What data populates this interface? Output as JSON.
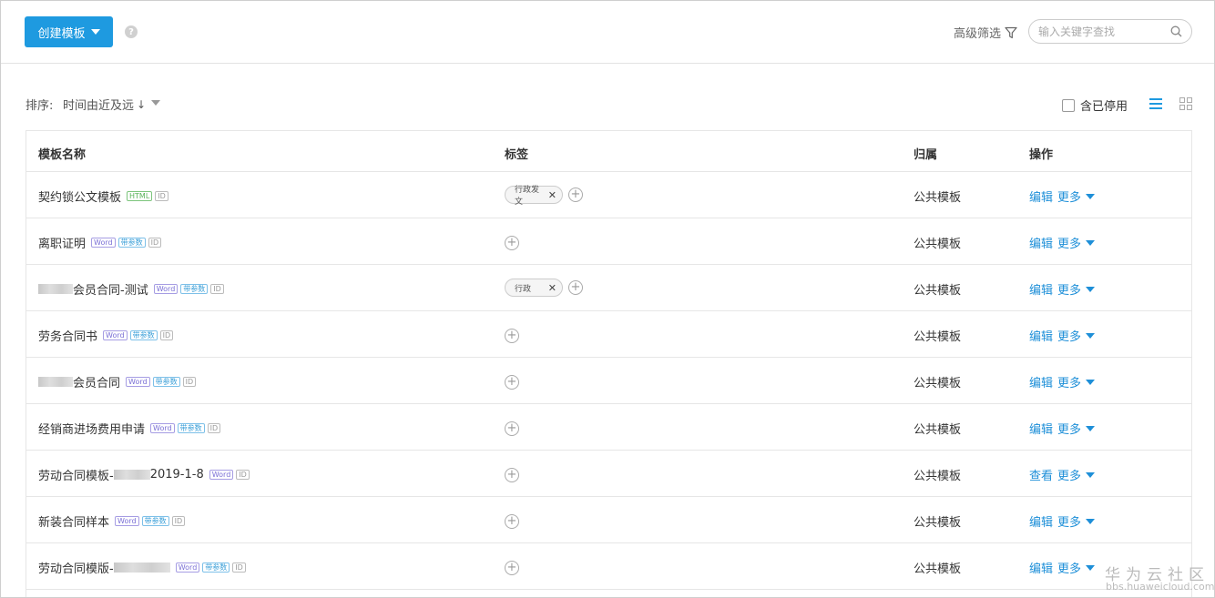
{
  "toolbar": {
    "create_label": "创建模板",
    "help_label": "?",
    "advanced_filter_label": "高级筛选",
    "search_placeholder": "输入关键字查找"
  },
  "sortbar": {
    "sort_label": "排序:",
    "sort_value": "时间由近及远",
    "sort_arrow": "↓",
    "include_disabled_label": "含已停用"
  },
  "table": {
    "headers": {
      "name": "模板名称",
      "tags": "标签",
      "owner": "归属",
      "ops": "操作"
    },
    "rows": [
      {
        "name_prefix": "",
        "name_suffix": "契约锁公文模板",
        "badges": [
          "HTML",
          "ID"
        ],
        "tags": [
          "行政发文"
        ],
        "owner": "公共模板",
        "action": "编辑",
        "more": "更多"
      },
      {
        "name_prefix": "",
        "name_suffix": "离职证明",
        "badges": [
          "Word",
          "带参数",
          "ID"
        ],
        "tags": [],
        "owner": "公共模板",
        "action": "编辑",
        "more": "更多"
      },
      {
        "name_prefix": "",
        "name_suffix": "会员合同-测试",
        "badges": [
          "Word",
          "带参数",
          "ID"
        ],
        "tags": [
          "行政"
        ],
        "owner": "公共模板",
        "action": "编辑",
        "more": "更多"
      },
      {
        "name_prefix": "",
        "name_suffix": "劳务合同书",
        "badges": [
          "Word",
          "带参数",
          "ID"
        ],
        "tags": [],
        "owner": "公共模板",
        "action": "编辑",
        "more": "更多"
      },
      {
        "name_prefix": "",
        "name_suffix": "会员合同",
        "badges": [
          "Word",
          "带参数",
          "ID"
        ],
        "tags": [],
        "owner": "公共模板",
        "action": "编辑",
        "more": "更多"
      },
      {
        "name_prefix": "",
        "name_suffix": "经销商进场费用申请",
        "badges": [
          "Word",
          "带参数",
          "ID"
        ],
        "tags": [],
        "owner": "公共模板",
        "action": "编辑",
        "more": "更多"
      },
      {
        "name_prefix": "劳动合同模板-",
        "name_suffix": "2019-1-8",
        "badges": [
          "Word",
          "ID"
        ],
        "tags": [],
        "owner": "公共模板",
        "action": "查看",
        "more": "更多"
      },
      {
        "name_prefix": "",
        "name_suffix": "新装合同样本",
        "badges": [
          "Word",
          "带参数",
          "ID"
        ],
        "tags": [],
        "owner": "公共模板",
        "action": "编辑",
        "more": "更多"
      },
      {
        "name_prefix": "劳动合同模版-",
        "name_suffix": "",
        "badges": [
          "Word",
          "带参数",
          "ID"
        ],
        "tags": [],
        "owner": "公共模板",
        "action": "编辑",
        "more": "更多"
      }
    ]
  },
  "watermark": {
    "text": "华为云社区",
    "url": "bbs.huaweicloud.com"
  },
  "colors": {
    "primary": "#1e9ae0",
    "link": "#1e8fd8",
    "html_badge": "#5ab35a",
    "word_badge": "#7a6fd6",
    "param_badge": "#3a9fd8"
  },
  "icons": [
    "help-icon",
    "filter-icon",
    "search-icon",
    "list-view-icon",
    "grid-view-icon",
    "close-icon",
    "add-icon",
    "caret-down-icon"
  ]
}
